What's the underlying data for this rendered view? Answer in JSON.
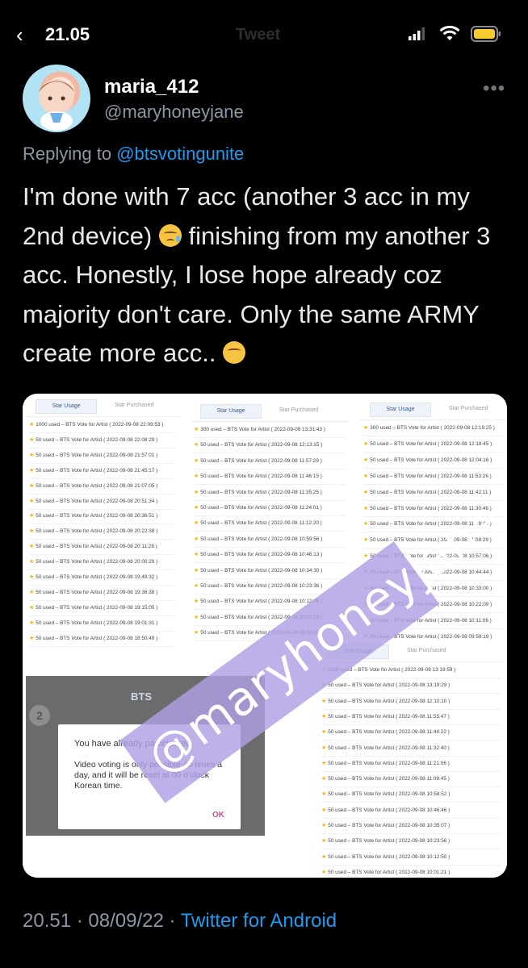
{
  "status_bar": {
    "time": "21.05",
    "header_title": "Tweet"
  },
  "tweet": {
    "display_name": "maria_412",
    "handle": "@maryhoneyjane",
    "more_icon": "more-dots-icon",
    "replying_prefix": "Replying to",
    "replying_to": "@btsvotingunite",
    "text_part1": "I'm done with 7 acc (another 3 acc in my 2nd device)",
    "text_part2": " finishing from my another 3 acc. Honestly, I lose hope already coz majority don't care. Only the same ARMY create more acc..",
    "emoji1": "smiling-face-with-tear-icon",
    "emoji2": "sneezing-face-icon",
    "timestamp": "20.51 · 08/09/22 ·",
    "client": "Twitter for Android"
  },
  "media": {
    "tab_usage": "Star Usage",
    "tab_purchased": "Star Purchased",
    "watermark": "@maryhoneyjane",
    "columns": [
      {
        "rows": [
          "1000 used – BTS Vote for Artist ( 2022-09-08 22:09:53 )",
          "50 used – BTS Vote for Artist ( 2022-09-08 22:08:29 )",
          "50 used – BTS Vote for Artist ( 2022-09-08 21:57:01 )",
          "50 used – BTS Vote for Artist ( 2022-09-08 21:45:17 )",
          "50 used – BTS Vote for Artist ( 2022-09-08 21:07:05 )",
          "50 used – BTS Vote for Artist ( 2022-09-08 20:51:34 )",
          "50 used – BTS Vote for Artist ( 2022-09-08 20:36:51 )",
          "50 used – BTS Vote for Artist ( 2022-09-08 20:22:38 )",
          "50 used – BTS Vote for Artist ( 2022-09-08 20:11:28 )",
          "50 used – BTS Vote for Artist ( 2022-09-08 20:00:29 )",
          "50 used – BTS Vote for Artist ( 2022-09-08 19:49:32 )",
          "50 used – BTS Vote for Artist ( 2022-09-08 19:36:38 )",
          "50 used – BTS Vote for Artist ( 2022-09-08 19:15:05 )",
          "50 used – BTS Vote for Artist ( 2022-09-08 19:01:31 )",
          "50 used – BTS Vote for Artist ( 2022-09-08 18:50:49 )"
        ]
      },
      {
        "rows": [
          "300 used – BTS Vote for Artist ( 2022-09-08 13:31:43 )",
          "50 used – BTS Vote for Artist ( 2022-09-08 12:13:15 )",
          "50 used – BTS Vote for Artist ( 2022-09-08 11:57:29 )",
          "50 used – BTS Vote for Artist ( 2022-09-08 11:46:15 )",
          "50 used – BTS Vote for Artist ( 2022-09-08 11:35:25 )",
          "50 used – BTS Vote for Artist ( 2022-09-08 11:24:01 )",
          "50 used – BTS Vote for Artist ( 2022-09-08 11:12:20 )",
          "50 used – BTS Vote for Artist ( 2022-09-08 10:59:56 )",
          "50 used – BTS Vote for Artist ( 2022-09-08 10:46:13 )",
          "50 used – BTS Vote for Artist ( 2022-09-08 10:34:30 )",
          "50 used – BTS Vote for Artist ( 2022-09-08 10:23:36 )",
          "50 used – BTS Vote for Artist ( 2022-09-08 10:12:05 )",
          "50 used – BTS Vote for Artist ( 2022-09-08 10:01:09 )",
          "50 used – BTS Vote for Artist ( 2022-09-08 09:50:22 )"
        ]
      },
      {
        "rows": [
          "300 used – BTS Vote for Artist ( 2022-09-08 12:19:25 )",
          "50 used – BTS Vote for Artist ( 2022-09-08 12:18:45 )",
          "50 used – BTS Vote for Artist ( 2022-09-08 12:04:16 )",
          "50 used – BTS Vote for Artist ( 2022-09-08 11:53:26 )",
          "50 used – BTS Vote for Artist ( 2022-09-08 11:42:11 )",
          "50 used – BTS Vote for Artist ( 2022-09-08 11:30:46 )",
          "50 used – BTS Vote for Artist ( 2022-09-08 11:19:46 )",
          "50 used – BTS Vote for Artist ( 2022-09-08 11:08:29 )",
          "50 used – BTS Vote for Artist ( 2022-09-08 10:57:06 )",
          "50 used – BTS Vote for Artist ( 2022-09-08 10:44:44 )",
          "50 used – BTS Vote for Artist ( 2022-09-08 10:33:00 )",
          "50 used – BTS Vote for Artist ( 2022-09-08 10:22:09 )",
          "50 used – BTS Vote for Artist ( 2022-09-08 10:11:06 )",
          "50 used – BTS Vote for Artist ( 2022-09-08 09:59:19 )"
        ]
      },
      {
        "rows": [
          "1000 used – BTS Vote for Artist ( 2022-09-08 13:19:59 )",
          "50 used – BTS Vote for Artist ( 2022-09-08 13:19:29 )",
          "50 used – BTS Vote for Artist ( 2022-09-08 12:10:10 )",
          "50 used – BTS Vote for Artist ( 2022-09-08 11:55:47 )",
          "50 used – BTS Vote for Artist ( 2022-09-08 11:44:22 )",
          "50 used – BTS Vote for Artist ( 2022-09-08 11:32:40 )",
          "50 used – BTS Vote for Artist ( 2022-09-08 11:21:06 )",
          "50 used – BTS Vote for Artist ( 2022-09-08 11:09:45 )",
          "50 used – BTS Vote for Artist ( 2022-09-08 10:58:52 )",
          "50 used – BTS Vote for Artist ( 2022-09-08 10:46:46 )",
          "50 used – BTS Vote for Artist ( 2022-09-08 10:35:07 )",
          "50 used – BTS Vote for Artist ( 2022-09-08 10:23:56 )",
          "50 used – BTS Vote for Artist ( 2022-09-08 10:12:50 )",
          "50 used – BTS Vote for Artist ( 2022-09-08 10:01:21 )"
        ]
      }
    ],
    "app_shot": {
      "brand": "BTS",
      "rank": "2",
      "dialog_title": "You have already participated.",
      "dialog_body": "Video voting is only possible 40 times a day, and it will be reset at 00 o'clock Korean time.",
      "dialog_ok": "OK"
    }
  }
}
